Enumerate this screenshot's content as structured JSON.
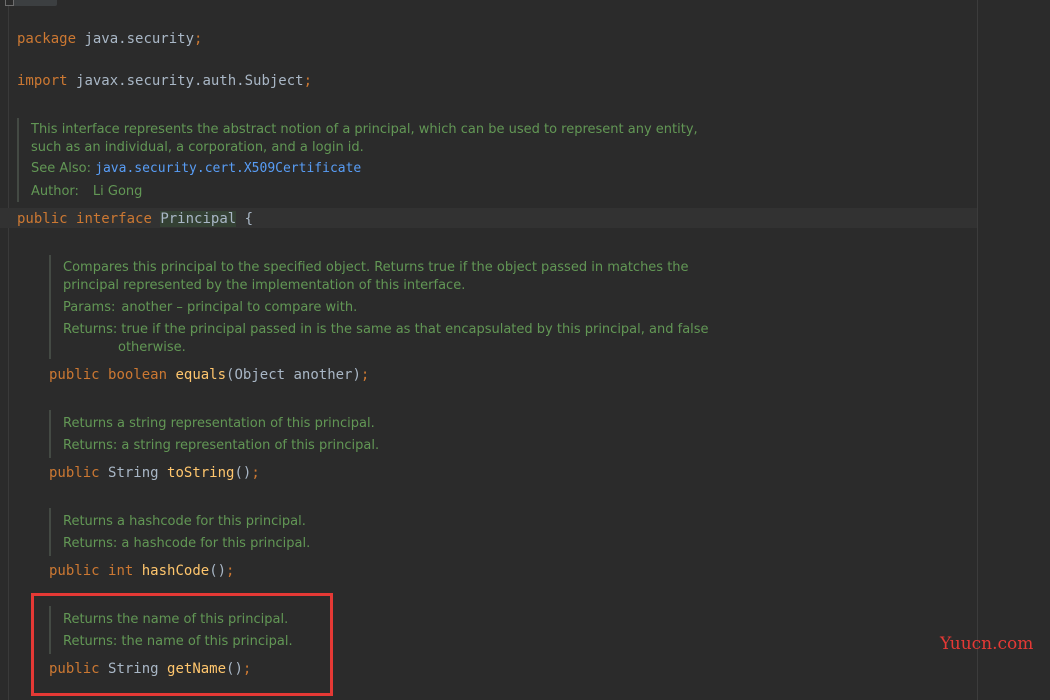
{
  "code": {
    "package_kw": "package",
    "package_name": "java.security",
    "semicolon": ";",
    "import_kw": "import",
    "import_name": "javax.security.auth.Subject",
    "public_kw": "public",
    "interface_kw": "interface",
    "interface_name": "Principal",
    "open_brace": " {",
    "boolean_kw": "boolean",
    "int_kw": "int",
    "string_type": "String",
    "equals_name": "equals",
    "equals_params": "(Object another)",
    "tostring_name": "toString",
    "hashcode_name": "hashCode",
    "getname_name": "getName",
    "empty_parens": "()"
  },
  "interface_doc": {
    "line1": "This interface represents the abstract notion of a principal, which can be used to represent any entity,",
    "line2": "such as an individual, a corporation, and a login id.",
    "see_also_label": "See Also:",
    "see_also_link": "java.security.cert.X509Certificate",
    "author_label": "Author:",
    "author_value": "Li Gong"
  },
  "equals_doc": {
    "line1": "Compares this principal to the specified object. Returns true if the object passed in matches the",
    "line2": "principal represented by the implementation of this interface.",
    "params_label": "Params:",
    "params_value": "another – principal to compare with.",
    "returns_label": "Returns:",
    "returns_line1": "true if the principal passed in is the same as that encapsulated by this principal, and false",
    "returns_line2": "otherwise."
  },
  "tostring_doc": {
    "line1": "Returns a string representation of this principal.",
    "returns": "Returns: a string representation of this principal."
  },
  "hashcode_doc": {
    "line1": "Returns a hashcode for this principal.",
    "returns": "Returns: a hashcode for this principal."
  },
  "getname_doc": {
    "line1": "Returns the name of this principal.",
    "returns": "Returns: the name of this principal."
  },
  "watermark": "Yuucn.com",
  "colors": {
    "background": "#2b2b2b",
    "keyword": "#cc7832",
    "method": "#ffc66d",
    "doc_text": "#629755",
    "link": "#589df6",
    "highlight_border": "#e53935"
  }
}
